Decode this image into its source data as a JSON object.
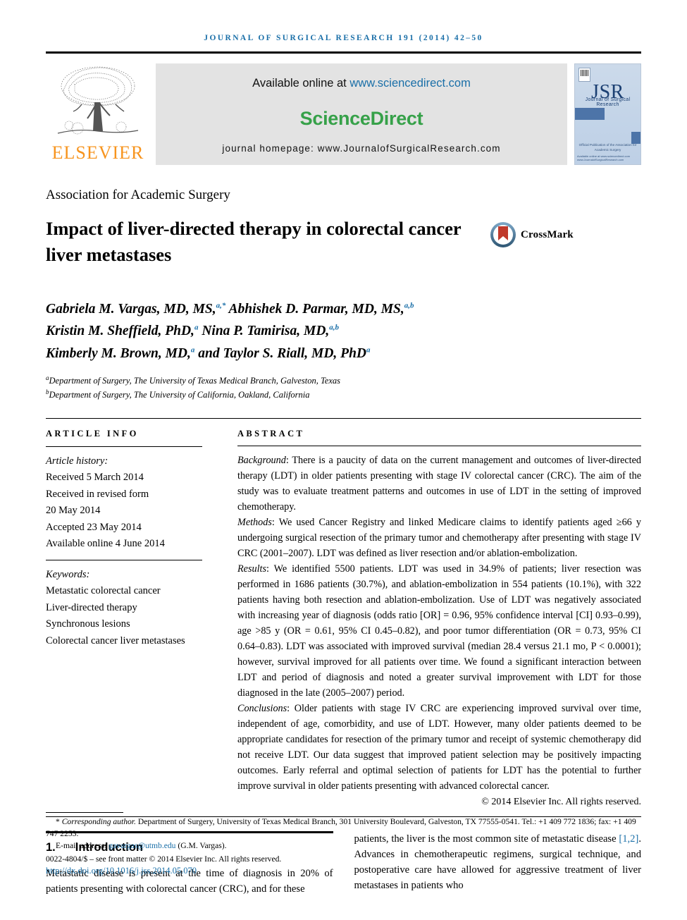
{
  "running_head": "JOURNAL OF SURGICAL RESEARCH 191 (2014) 42–50",
  "masthead": {
    "publisher_name": "ELSEVIER",
    "available_prefix": "Available online at ",
    "available_url": "www.sciencedirect.com",
    "sciencedirect_logo": "ScienceDirect",
    "homepage_line": "journal homepage: www.JournalofSurgicalResearch.com",
    "cover": {
      "title": "JSR",
      "subtitle": "Journal of Surgical Research",
      "association_line": "Official Publication of the Association for Academic Surgery",
      "footer_line": "Available online at www.sciencedirect.com  www.JournalofSurgicalResearch.com"
    },
    "colors": {
      "link_blue": "#1a6fa8",
      "sciencedirect_green": "#36a149",
      "elsevier_orange": "#f7941e",
      "cover_blue": "#1b3f72"
    }
  },
  "article": {
    "society": "Association for Academic Surgery",
    "title": "Impact of liver-directed therapy in colorectal cancer liver metastases",
    "crossmark_label": "CrossMark",
    "authors_lines": [
      "Gabriela M. Vargas, MD, MS,",
      "Kristin M. Sheffield, PhD,",
      "Kimberly M. Brown, MD,"
    ],
    "authors_full": [
      {
        "name": "Gabriela M. Vargas, MD, MS,",
        "sup": "a,*"
      },
      {
        "name": "Abhishek D. Parmar, MD, MS,",
        "sup": "a,b"
      },
      {
        "name": "Kristin M. Sheffield, PhD,",
        "sup": "a"
      },
      {
        "name": "Nina P. Tamirisa, MD,",
        "sup": "a,b"
      },
      {
        "name": "Kimberly M. Brown, MD,",
        "sup": "a"
      },
      {
        "name": "and Taylor S. Riall, MD, PhD",
        "sup": "a"
      }
    ],
    "affiliations": [
      {
        "mark": "a",
        "text": "Department of Surgery, The University of Texas Medical Branch, Galveston, Texas"
      },
      {
        "mark": "b",
        "text": "Department of Surgery, The University of California, Oakland, California"
      }
    ]
  },
  "article_info": {
    "heading": "ARTICLE INFO",
    "history_label": "Article history:",
    "history": [
      "Received 5 March 2014",
      "Received in revised form",
      "20 May 2014",
      "Accepted 23 May 2014",
      "Available online 4 June 2014"
    ],
    "keywords_label": "Keywords:",
    "keywords": [
      "Metastatic colorectal cancer",
      "Liver-directed therapy",
      "Synchronous lesions",
      "Colorectal cancer liver metastases"
    ]
  },
  "abstract": {
    "heading": "ABSTRACT",
    "sections": [
      {
        "label": "Background",
        "text": ": There is a paucity of data on the current management and outcomes of liver-directed therapy (LDT) in older patients presenting with stage IV colorectal cancer (CRC). The aim of the study was to evaluate treatment patterns and outcomes in use of LDT in the setting of improved chemotherapy."
      },
      {
        "label": "Methods",
        "text": ": We used Cancer Registry and linked Medicare claims to identify patients aged ≥66 y undergoing surgical resection of the primary tumor and chemotherapy after presenting with stage IV CRC (2001–2007). LDT was defined as liver resection and/or ablation-embolization."
      },
      {
        "label": "Results",
        "text": ": We identified 5500 patients. LDT was used in 34.9% of patients; liver resection was performed in 1686 patients (30.7%), and ablation-embolization in 554 patients (10.1%), with 322 patients having both resection and ablation-embolization. Use of LDT was negatively associated with increasing year of diagnosis (odds ratio [OR] = 0.96, 95% confidence interval [CI] 0.93–0.99), age >85 y (OR = 0.61, 95% CI 0.45–0.82), and poor tumor differentiation (OR = 0.73, 95% CI 0.64–0.83). LDT was associated with improved survival (median 28.4 versus 21.1 mo, P < 0.0001); however, survival improved for all patients over time. We found a significant interaction between LDT and period of diagnosis and noted a greater survival improvement with LDT for those diagnosed in the late (2005–2007) period."
      },
      {
        "label": "Conclusions",
        "text": ": Older patients with stage IV CRC are experiencing improved survival over time, independent of age, comorbidity, and use of LDT. However, many older patients deemed to be appropriate candidates for resection of the primary tumor and receipt of systemic chemotherapy did not receive LDT. Our data suggest that improved patient selection may be positively impacting outcomes. Early referral and optimal selection of patients for LDT has the potential to further improve survival in older patients presenting with advanced colorectal cancer."
      }
    ],
    "copyright": "© 2014 Elsevier Inc. All rights reserved."
  },
  "introduction": {
    "number": "1.",
    "title": "Introduction",
    "left_text": "Metastatic disease is present at the time of diagnosis in 20% of patients presenting with colorectal cancer (CRC), and for these",
    "right_text_before": "patients, the liver is the most common site of metastatic disease ",
    "right_citation": "[1,2]",
    "right_text_after": ". Advances in chemotherapeutic regimens, surgical technique, and postoperative care have allowed for aggressive treatment of liver metastases in patients who"
  },
  "footnotes": {
    "corresponding_marker": "*",
    "corresponding_label": "Corresponding author.",
    "corresponding_text": " Department of Surgery, University of Texas Medical Branch, 301 University Boulevard, Galveston, TX 77555-0541. Tel.: +1 409 772 1836; fax: +1 409 747 2253.",
    "email_label": "E-mail address: ",
    "email": "gavargas@utmb.edu",
    "email_suffix": " (G.M. Vargas).",
    "issn_line": "0022-4804/$ – see front matter © 2014 Elsevier Inc. All rights reserved.",
    "doi": "http://dx.doi.org/10.1016/j.jss.2014.05.070"
  }
}
